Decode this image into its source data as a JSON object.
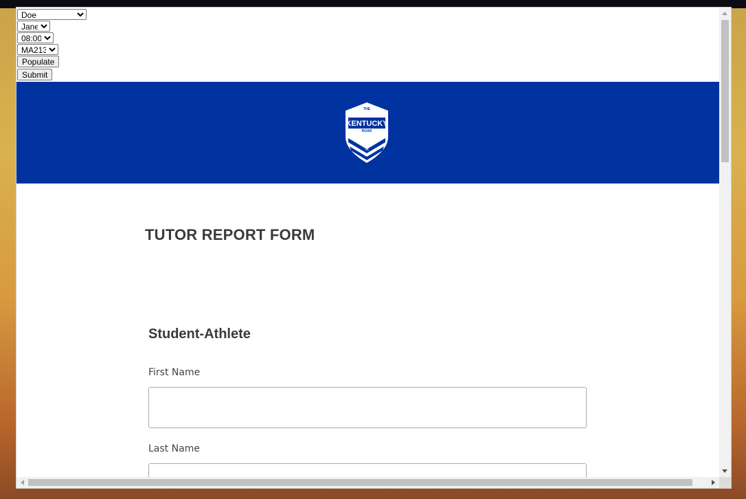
{
  "dev_controls": {
    "last_name_select": {
      "selected": "Doe",
      "options": [
        "Doe"
      ]
    },
    "first_name_select": {
      "selected": "Jane",
      "options": [
        "Jane"
      ]
    },
    "time_select": {
      "selected": "08:00",
      "options": [
        "08:00"
      ]
    },
    "course_select": {
      "selected": "MA213",
      "options": [
        "MA213"
      ]
    },
    "populate_label": "Populate",
    "submit_label": "Submit"
  },
  "banner": {
    "color": "#0033a0",
    "logo": {
      "icon": "kentucky-road-shield-logo",
      "text_top": "THE",
      "text_main": "KENTUCKY",
      "text_sub": "ROAD"
    }
  },
  "form": {
    "title": "TUTOR REPORT FORM",
    "section_title": "Student-Athlete",
    "fields": [
      {
        "label": "First Name",
        "value": ""
      },
      {
        "label": "Last Name",
        "value": ""
      }
    ]
  }
}
